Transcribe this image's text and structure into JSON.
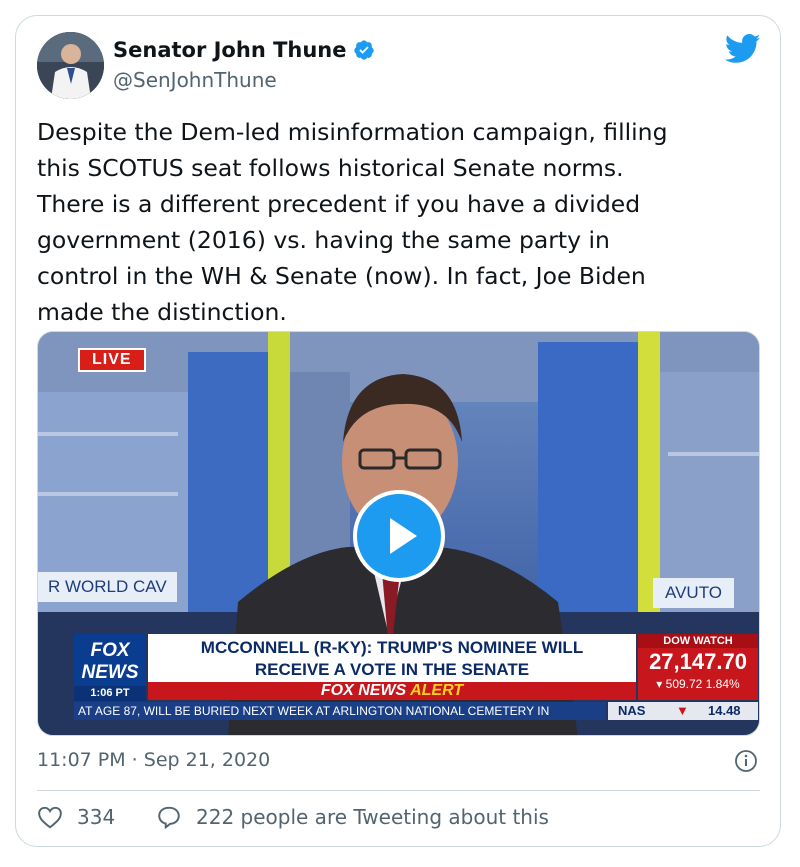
{
  "author": {
    "name": "Senator John Thune",
    "handle": "@SenJohnThune",
    "verified_icon": "verified-badge-icon"
  },
  "tweet": {
    "text": "Despite the Dem-led misinformation campaign, filling\nthis SCOTUS seat follows historical Senate norms.\nThere is a different precedent if you have a divided\ngovernment (2016) vs. having the same party in\ncontrol in the WH & Senate (now). In fact, Joe Biden\nmade the distinction."
  },
  "video": {
    "live_badge": "LIVE",
    "wall_text_left": "R WORLD CAV",
    "wall_text_right": "AVUTO",
    "fox_logo_line1": "FOX",
    "fox_logo_line2": "NEWS",
    "fox_time": "1:06 PT",
    "headline_line1": "MCCONNELL (R-KY): TRUMP'S NOMINEE WILL",
    "headline_line2": "RECEIVE A VOTE IN THE SENATE",
    "alert_word1": "FOX NEWS",
    "alert_word2": "ALERT",
    "dow_label": "DOW WATCH",
    "dow_value": "27,147.70",
    "dow_change": "509.72 1.84%",
    "ticker_text": "AT AGE 87, WILL BE BURIED NEXT WEEK AT ARLINGTON NATIONAL CEMETERY IN",
    "nas_label": "NAS",
    "nas_value": "14.48",
    "play_icon": "play-icon"
  },
  "meta": {
    "timestamp": "11:07 PM · Sep 21, 2020"
  },
  "engagement": {
    "likes": "334",
    "replies_text": "222 people are Tweeting about this"
  },
  "colors": {
    "twitter_blue": "#1d9bf0",
    "text_primary": "#0f1419",
    "text_secondary": "#536471",
    "border": "#cfd9de"
  }
}
